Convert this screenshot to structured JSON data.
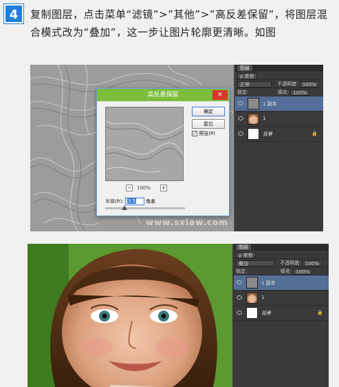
{
  "step": {
    "number": "4",
    "instruction": "复制图层，点击菜单“滤镜”>”其他”>”高反差保留”，将图层混合模式改为“叠加”，这一步让图片轮廓更清晰。如图"
  },
  "dialog": {
    "title": "高反差保留",
    "close_label": "✕",
    "ok_label": "确定",
    "reset_label": "复位",
    "preview_label": "预览(P)",
    "preview_checked": "✓",
    "zoom_out": "−",
    "zoom_in": "+",
    "zoom_value": "100%",
    "radius_label": "半径(R):",
    "radius_value": "3.5",
    "radius_unit": "像素"
  },
  "watermark": "www.sxiaw.com",
  "panel1": {
    "tab": "图层",
    "kind": "ρ 类型",
    "mode": "正常",
    "opacity_label": "不透明度:",
    "opacity_value": "100%",
    "lock_label": "锁定:",
    "fill_label": "填充:",
    "fill_value": "100%",
    "layers": [
      "1 副本",
      "1",
      "背景"
    ]
  },
  "panel2": {
    "tab": "图层",
    "kind": "ρ 类型",
    "mode": "叠加",
    "opacity_label": "不透明度:",
    "opacity_value": "100%",
    "lock_label": "锁定:",
    "fill_label": "填充:",
    "fill_value": "100%",
    "layers": [
      "1 副本",
      "1",
      "背景"
    ]
  },
  "colors": {
    "badge": "#1f7fd8",
    "dialog_title": "#7cbd3e",
    "active_layer": "#536e97",
    "panel_bg": "#3a3a3a"
  }
}
